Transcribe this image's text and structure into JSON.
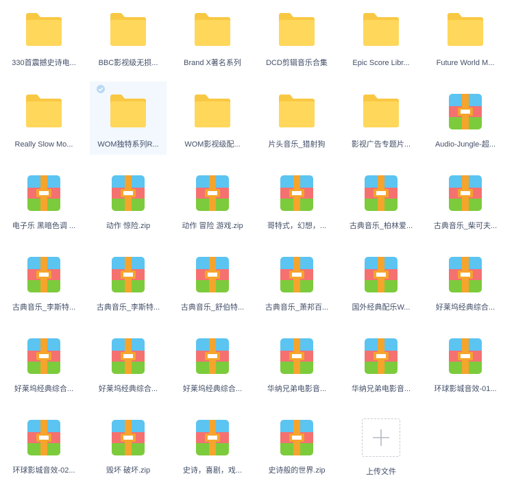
{
  "items": [
    {
      "type": "folder",
      "name": "330首震撼史诗电..."
    },
    {
      "type": "folder",
      "name": "BBC影视级无损..."
    },
    {
      "type": "folder",
      "name": "Brand X著名系列"
    },
    {
      "type": "folder",
      "name": "DCD剪辑音乐合集"
    },
    {
      "type": "folder",
      "name": "Epic Score Libr..."
    },
    {
      "type": "folder",
      "name": "Future World M..."
    },
    {
      "type": "folder",
      "name": "Really Slow Mo..."
    },
    {
      "type": "folder",
      "name": "WOM独特系列R...",
      "selected": true
    },
    {
      "type": "folder",
      "name": "WOM影视级配..."
    },
    {
      "type": "folder",
      "name": "片头音乐_猎射狗"
    },
    {
      "type": "folder",
      "name": "影视广告专题片..."
    },
    {
      "type": "zip",
      "name": "Audio-Jungle-超..."
    },
    {
      "type": "zip",
      "name": "电子乐 黑暗色调 ..."
    },
    {
      "type": "zip",
      "name": "动作 惊险.zip"
    },
    {
      "type": "zip",
      "name": "动作 冒险 游戏.zip"
    },
    {
      "type": "zip",
      "name": "哥特式，幻想，..."
    },
    {
      "type": "zip",
      "name": "古典音乐_柏林爱..."
    },
    {
      "type": "zip",
      "name": "古典音乐_柴可夫..."
    },
    {
      "type": "zip",
      "name": "古典音乐_李斯特..."
    },
    {
      "type": "zip",
      "name": "古典音乐_李斯特..."
    },
    {
      "type": "zip",
      "name": "古典音乐_舒伯特..."
    },
    {
      "type": "zip",
      "name": "古典音乐_萧邦百..."
    },
    {
      "type": "zip",
      "name": "国外经典配乐W..."
    },
    {
      "type": "zip",
      "name": "好莱坞经典综合..."
    },
    {
      "type": "zip",
      "name": "好莱坞经典综合..."
    },
    {
      "type": "zip",
      "name": "好莱坞经典综合..."
    },
    {
      "type": "zip",
      "name": "好莱坞经典综合..."
    },
    {
      "type": "zip",
      "name": "华纳兄弟电影音..."
    },
    {
      "type": "zip",
      "name": "华纳兄弟电影音..."
    },
    {
      "type": "zip",
      "name": "环球影城音效-01..."
    },
    {
      "type": "zip",
      "name": "环球影城音效-02..."
    },
    {
      "type": "zip",
      "name": "毁坏  破坏.zip"
    },
    {
      "type": "zip",
      "name": "史诗，喜剧，戏..."
    },
    {
      "type": "zip",
      "name": "史诗般的世界.zip"
    },
    {
      "type": "upload",
      "name": "上传文件"
    }
  ],
  "colors": {
    "folder_back": "#f9c843",
    "folder_front": "#ffd75b",
    "zip_blue": "#5bc4f1",
    "zip_red": "#f47170",
    "zip_green": "#7ccb3c",
    "zip_strap": "#f5a42c",
    "label_text": "#424e67",
    "selected_bg": "#f2f8fe"
  }
}
